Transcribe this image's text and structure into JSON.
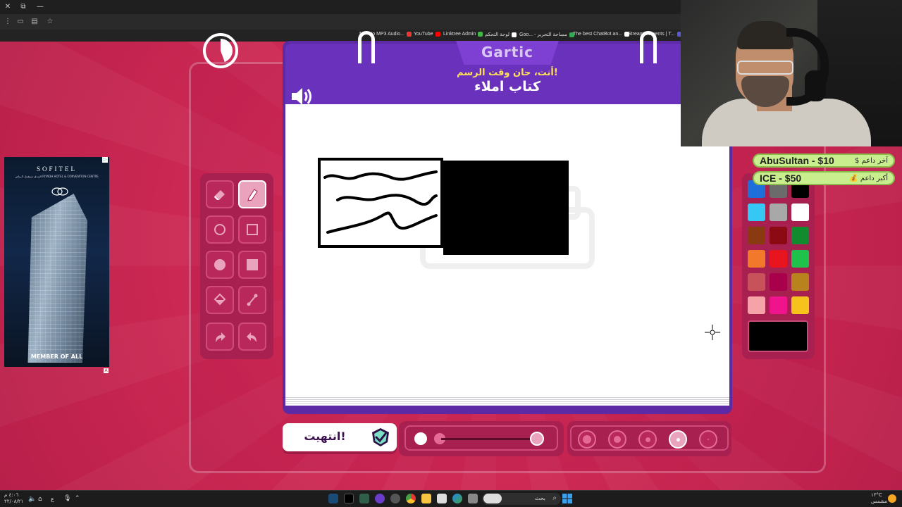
{
  "window_controls": {
    "close": "✕",
    "restore": "⧉",
    "minimize": "—"
  },
  "bookmarks": [
    {
      "label": "MP4 to MP3 Audio...",
      "color": "#e53935"
    },
    {
      "label": "YouTube",
      "color": "#ff0000"
    },
    {
      "label": "Linktree Admin",
      "color": "#43b649"
    },
    {
      "label": "لوحة التحكم",
      "color": "#ffffff"
    },
    {
      "label": "Goo... - مساحة التحرير",
      "color": "#34a853"
    },
    {
      "label": "The best ChatBot an...",
      "color": "#ffffff"
    },
    {
      "label": "StreamElements | T...",
      "color": "#5b5bd6"
    }
  ],
  "ad": {
    "brand": "SOFITEL",
    "subtitle": "الفندق سوفيتل الرياض RIYADH HOTEL & CONVENTION CENTRE",
    "member": "MEMBER OF ALL"
  },
  "game": {
    "logo": "Gartic",
    "message": "أنت، حان وقت الرسم!",
    "word": "كتاب املاء",
    "done_label": "انتهيت!"
  },
  "donations": [
    {
      "name": "AbuSultan - $10",
      "label": "$ آخر داعم"
    },
    {
      "name": "ICE - $50",
      "label": "💰 أكبر داعم"
    }
  ],
  "tools": [
    {
      "name": "eraser-tool",
      "icon": "eraser-icon"
    },
    {
      "name": "pencil-tool",
      "icon": "pencil-icon",
      "active": true
    },
    {
      "name": "ellipse-outline-tool",
      "icon": "circle-outline-icon"
    },
    {
      "name": "rect-outline-tool",
      "icon": "square-outline-icon"
    },
    {
      "name": "ellipse-fill-tool",
      "icon": "circle-fill-icon"
    },
    {
      "name": "rect-fill-tool",
      "icon": "square-fill-icon"
    },
    {
      "name": "bucket-tool",
      "icon": "paint-bucket-icon"
    },
    {
      "name": "line-tool",
      "icon": "line-icon"
    },
    {
      "name": "undo-tool",
      "icon": "undo-icon"
    },
    {
      "name": "redo-tool",
      "icon": "redo-icon"
    }
  ],
  "palette": [
    "#1e6fd9",
    "#6b6b6b",
    "#000000",
    "#35c8f5",
    "#a8a8a8",
    "#ffffff",
    "#8a3a10",
    "#8c0a14",
    "#128a2e",
    "#f2792a",
    "#e8141e",
    "#1fc24a",
    "#c8525a",
    "#a8004a",
    "#b8821c",
    "#f5a3a8",
    "#f0148c",
    "#f5c31c"
  ],
  "current_color": "#000000",
  "brush_size_level": 0.9,
  "opacity_selected_index": 3,
  "taskbar": {
    "search_placeholder": "بحث",
    "time": "٤:٠٦ م",
    "date": "٢٢/٠٨/٢١",
    "weather": "١٣°C",
    "weather_desc": "مشمس",
    "lang": "ع"
  }
}
